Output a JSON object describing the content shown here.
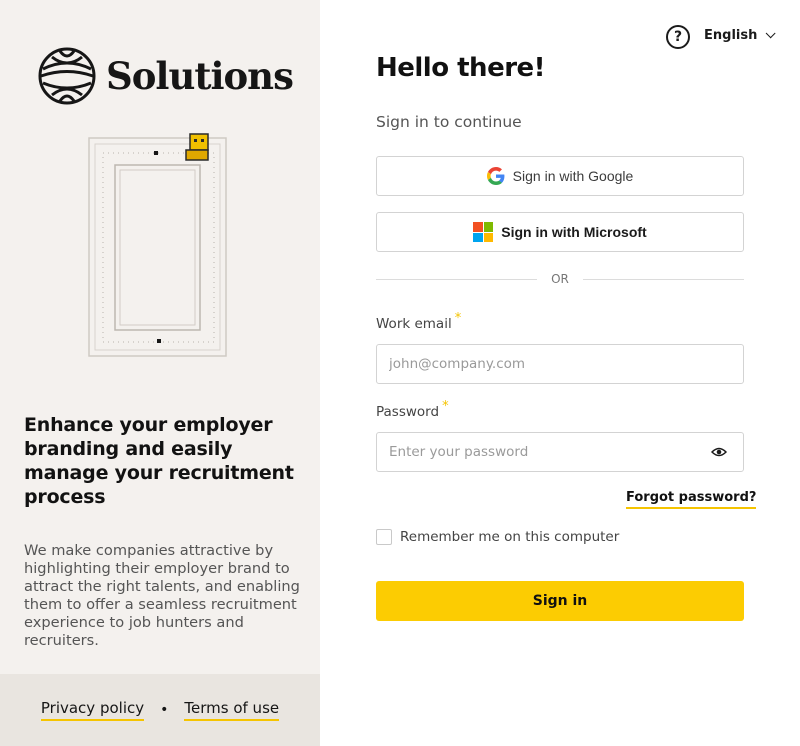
{
  "brand": {
    "name": "Solutions",
    "logo_icon": "solutions-logo-icon",
    "accent_color": "#fccc02"
  },
  "left": {
    "headline": "Enhance your employer branding and easily manage your recruitment process",
    "description": "We make companies attractive by highlighting their employer brand to attract the right talents, and enabling them to offer a seamless recruitment experience to job hunters and recruiters.",
    "footer": {
      "privacy": "Privacy policy",
      "separator": "•",
      "terms": "Terms of use"
    }
  },
  "header": {
    "help_icon": "question-circle-icon",
    "help_glyph": "?",
    "language": "English"
  },
  "login": {
    "title": "Hello there!",
    "subtitle": "Sign in to continue",
    "google_label": "Sign in with Google",
    "microsoft_label": "Sign in with Microsoft",
    "divider": "OR",
    "email_label": "Work email",
    "email_placeholder": "john@company.com",
    "password_label": "Password",
    "password_placeholder": "Enter your password",
    "required_mark": "*",
    "forgot": "Forgot password?",
    "remember": "Remember me on this computer",
    "submit": "Sign in"
  }
}
